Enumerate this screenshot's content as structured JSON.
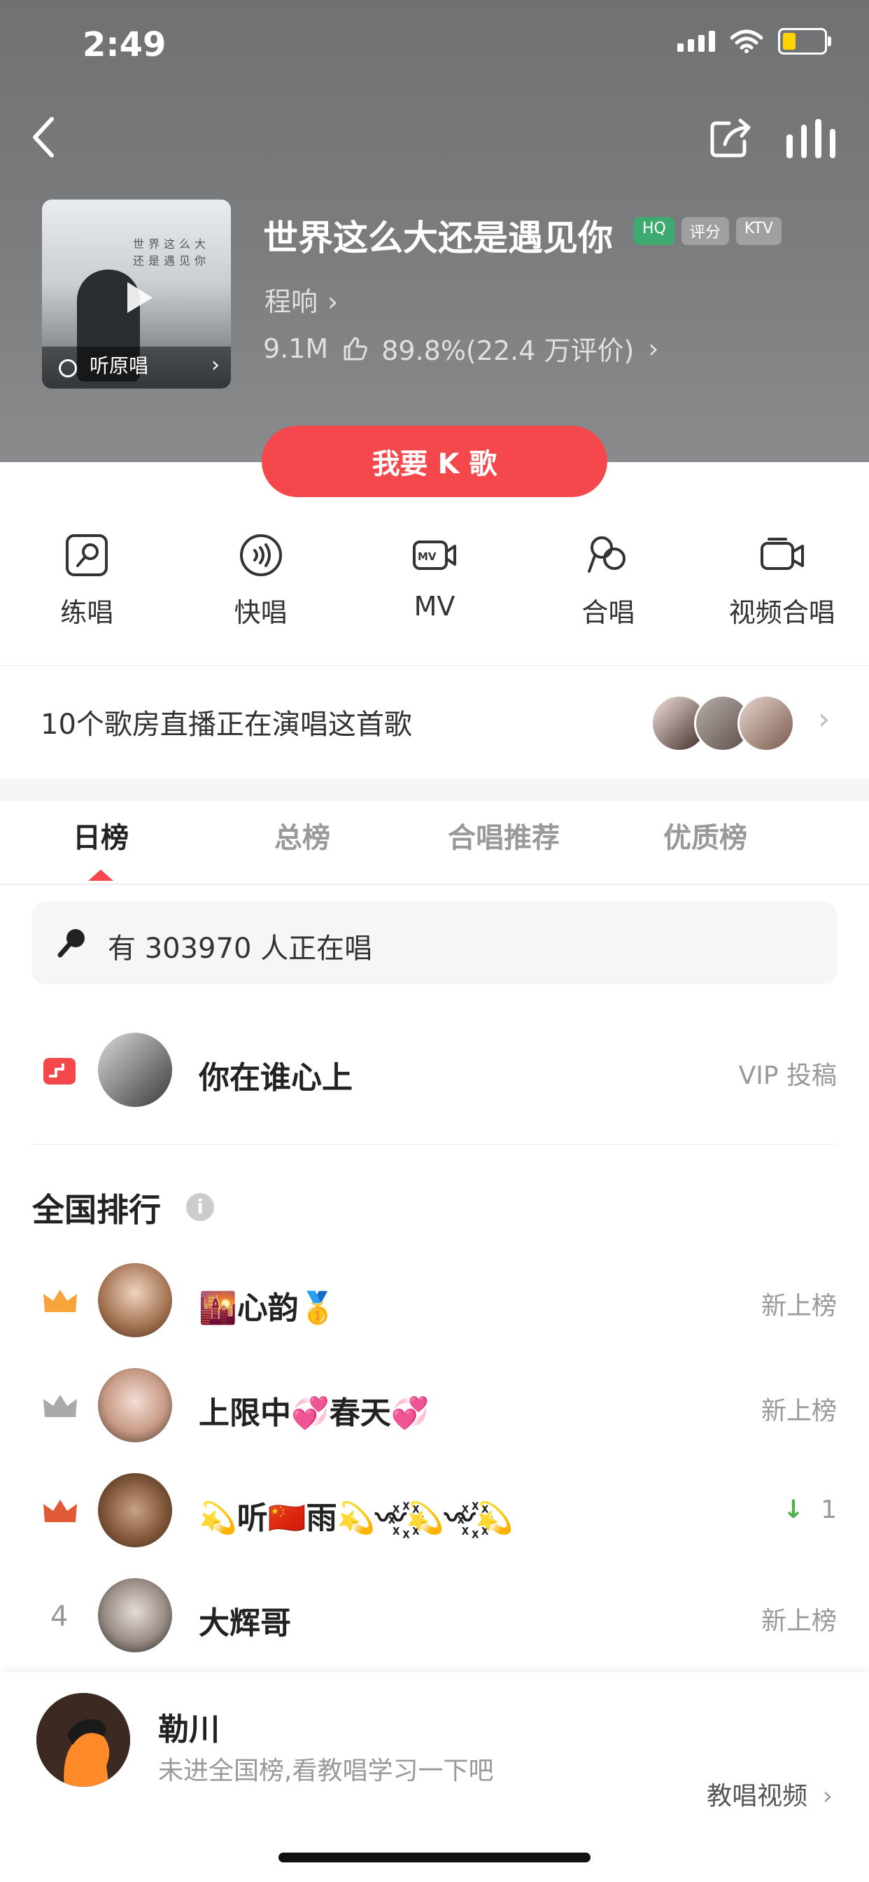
{
  "status_bar": {
    "time": "2:49"
  },
  "song": {
    "title": "世界这么大还是遇见你",
    "badges": [
      "HQ",
      "评分",
      "KTV"
    ],
    "artist": "程响",
    "plays": "9.1M",
    "rating": "89.8%(22.4 万评价)",
    "cover_label": "听原唱"
  },
  "primary_button": "我要 K 歌",
  "actions": [
    {
      "label": "练唱",
      "icon": "mic-practice-icon"
    },
    {
      "label": "快唱",
      "icon": "quick-sing-icon"
    },
    {
      "label": "MV",
      "icon": "mv-icon"
    },
    {
      "label": "合唱",
      "icon": "duet-icon"
    },
    {
      "label": "视频合唱",
      "icon": "video-duet-icon"
    }
  ],
  "live": {
    "text": "10个歌房直播正在演唱这首歌"
  },
  "tabs": [
    {
      "label": "日榜",
      "active": true
    },
    {
      "label": "总榜",
      "active": false
    },
    {
      "label": "合唱推荐",
      "active": false
    },
    {
      "label": "优质榜",
      "active": false
    }
  ],
  "singing_now": "有 303970 人正在唱",
  "featured": {
    "name": "你在谁心上",
    "tag": "VIP 投稿"
  },
  "national": {
    "title": "全国排行",
    "rows": [
      {
        "rank": "1",
        "name": "🌇心韵🥇",
        "status": "新上榜"
      },
      {
        "rank": "2",
        "name": "上限中💞春天💞",
        "status": "新上榜"
      },
      {
        "rank": "3",
        "name": "💫听🇨🇳雨💫〰꙰💫〰꙰💫",
        "status": "1"
      },
      {
        "rank": "4",
        "name": "大辉哥",
        "status": "新上榜"
      }
    ]
  },
  "me": {
    "name": "勒川",
    "hint": "未进全国榜,看教唱学习一下吧",
    "video_link": "教唱视频"
  },
  "colors": {
    "accent": "#f4484c",
    "hq_green": "#3daa6f",
    "down_green": "#4caf50"
  }
}
